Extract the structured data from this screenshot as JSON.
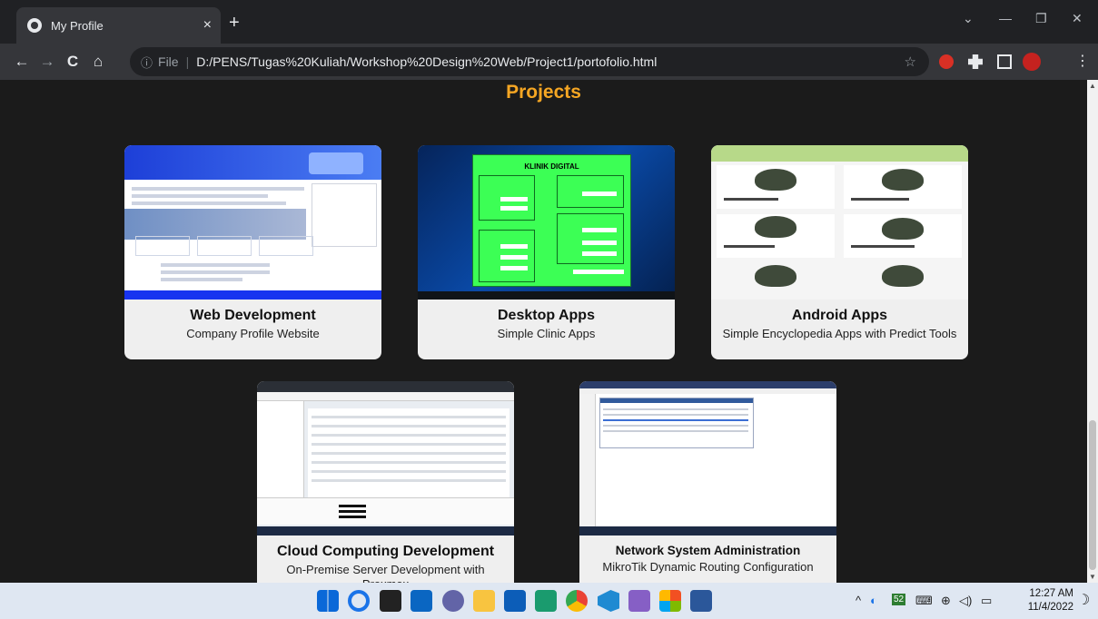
{
  "browser": {
    "tab_title": "My Profile",
    "tab_close": "×",
    "new_tab": "+",
    "nav_back": "←",
    "nav_forward": "→",
    "nav_reload": "C",
    "nav_home": "⌂",
    "info_icon": "ⓘ",
    "scheme": "File",
    "separator": "|",
    "url": "D:/PENS/Tugas%20Kuliah/Workshop%20Design%20Web/Project1/portofolio.html",
    "win_minimize": "—",
    "win_restore": "❐",
    "win_close": "✕",
    "tab_search": "⌄"
  },
  "page": {
    "title": "Projects",
    "title_color": "#f5a623",
    "projects": [
      {
        "title": "Web Development",
        "desc": "Company Profile Website"
      },
      {
        "title": "Desktop Apps",
        "desc": "Simple Clinic Apps",
        "thumb_heading": "KLINIK DIGITAL"
      },
      {
        "title": "Android Apps",
        "desc": "Simple Encyclopedia Apps with Predict Tools"
      },
      {
        "title": "Cloud Computing Development",
        "desc": "On-Premise Server Development with Proxmox"
      },
      {
        "title": "Network System Administration",
        "desc": "MikroTik Dynamic Routing Configuration"
      }
    ]
  },
  "taskbar": {
    "clock_time": "12:27 AM",
    "clock_date": "11/4/2022",
    "tray_chevron": "^",
    "tray_badge": "52"
  }
}
